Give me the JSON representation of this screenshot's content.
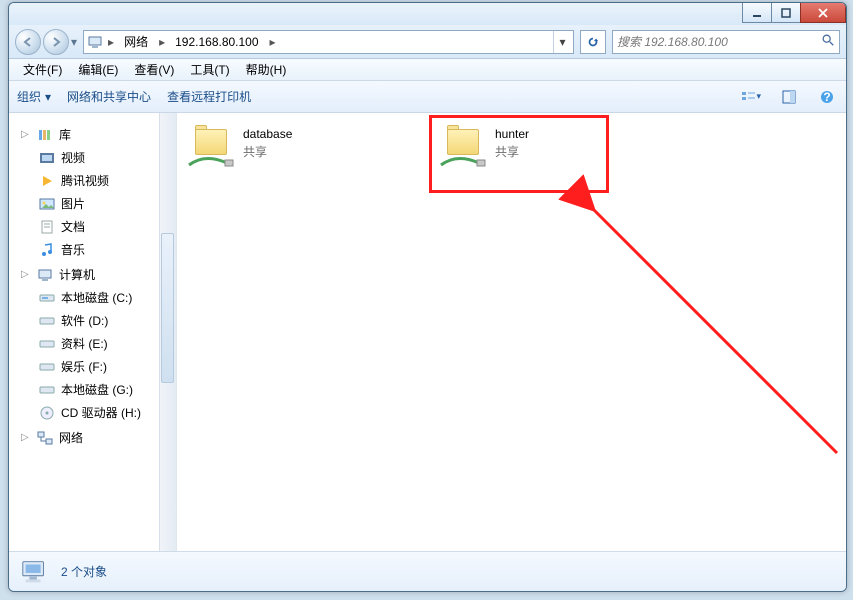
{
  "address": {
    "root_label": "网络",
    "path_label": "192.168.80.100"
  },
  "search": {
    "placeholder": "搜索 192.168.80.100"
  },
  "menus": {
    "file": "文件(F)",
    "edit": "编辑(E)",
    "view": "查看(V)",
    "tools": "工具(T)",
    "help": "帮助(H)"
  },
  "toolbar": {
    "organize": "组织",
    "network_center": "网络和共享中心",
    "view_printers": "查看远程打印机"
  },
  "sidebar": {
    "libraries": {
      "label": "库",
      "items": [
        {
          "label": "视频"
        },
        {
          "label": "腾讯视频"
        },
        {
          "label": "图片"
        },
        {
          "label": "文档"
        },
        {
          "label": "音乐"
        }
      ]
    },
    "computer": {
      "label": "计算机",
      "items": [
        {
          "label": "本地磁盘 (C:)"
        },
        {
          "label": "软件 (D:)"
        },
        {
          "label": "资料 (E:)"
        },
        {
          "label": "娱乐 (F:)"
        },
        {
          "label": "本地磁盘 (G:)"
        },
        {
          "label": "CD 驱动器 (H:)"
        }
      ]
    },
    "network": {
      "label": "网络"
    }
  },
  "content": {
    "items": [
      {
        "name": "database",
        "subtitle": "共享"
      },
      {
        "name": "hunter",
        "subtitle": "共享"
      }
    ]
  },
  "status": {
    "text": "2 个对象"
  }
}
